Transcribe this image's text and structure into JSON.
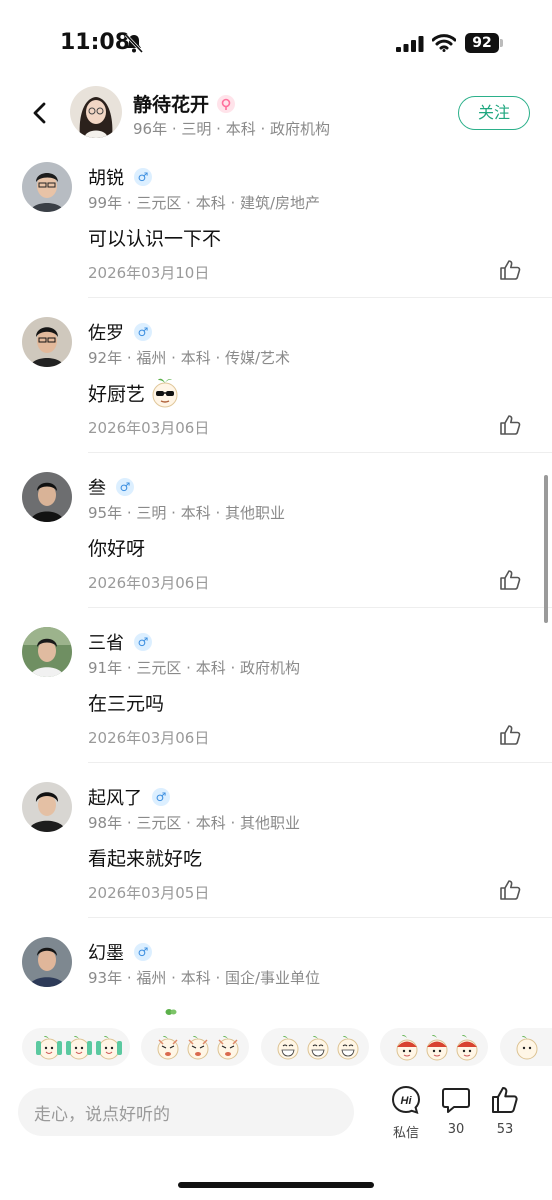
{
  "status_bar": {
    "time": "11:08",
    "battery": "92",
    "icons": [
      "bell-off-icon",
      "cellular-signal-icon",
      "wifi-icon",
      "battery-icon"
    ]
  },
  "header": {
    "title": "静待花开",
    "meta": "96年 · 三明 · 本科 · 政府机构",
    "follow_label": "关注",
    "accent_color": "#1fa77f",
    "badge_color": "#ff6f9c"
  },
  "comments": [
    {
      "name": "胡锐",
      "gender": "♂",
      "meta": "99年 · 三元区 · 本科 · 建筑/房地产",
      "text": "可以认识一下不",
      "date": "2026年03月10日"
    },
    {
      "name": "佐罗",
      "gender": "♂",
      "meta": "92年 · 福州 · 本科 · 传媒/艺术",
      "text": "好厨艺",
      "date": "2026年03月06日"
    },
    {
      "name": "叁",
      "gender": "♂",
      "meta": "95年 · 三明 · 本科 · 其他职业",
      "text": "你好呀",
      "date": "2026年03月06日"
    },
    {
      "name": "三省",
      "gender": "♂",
      "meta": "91年 · 三元区 · 本科 · 政府机构",
      "text": "在三元吗",
      "date": "2026年03月06日"
    },
    {
      "name": "起风了",
      "gender": "♂",
      "meta": "98年 · 三元区 · 本科 · 其他职业",
      "text": "看起来就好吃",
      "date": "2026年03月05日"
    },
    {
      "name": "幻墨",
      "gender": "♂",
      "meta": "93年 · 福州 · 本科 · 国企/事业单位",
      "text": "",
      "date": ""
    }
  ],
  "input": {
    "placeholder": "走心，说点好听的"
  },
  "actions": {
    "message_label": "私信",
    "message_icon_text": "Hi",
    "comment_count": "30",
    "like_count": "53"
  }
}
